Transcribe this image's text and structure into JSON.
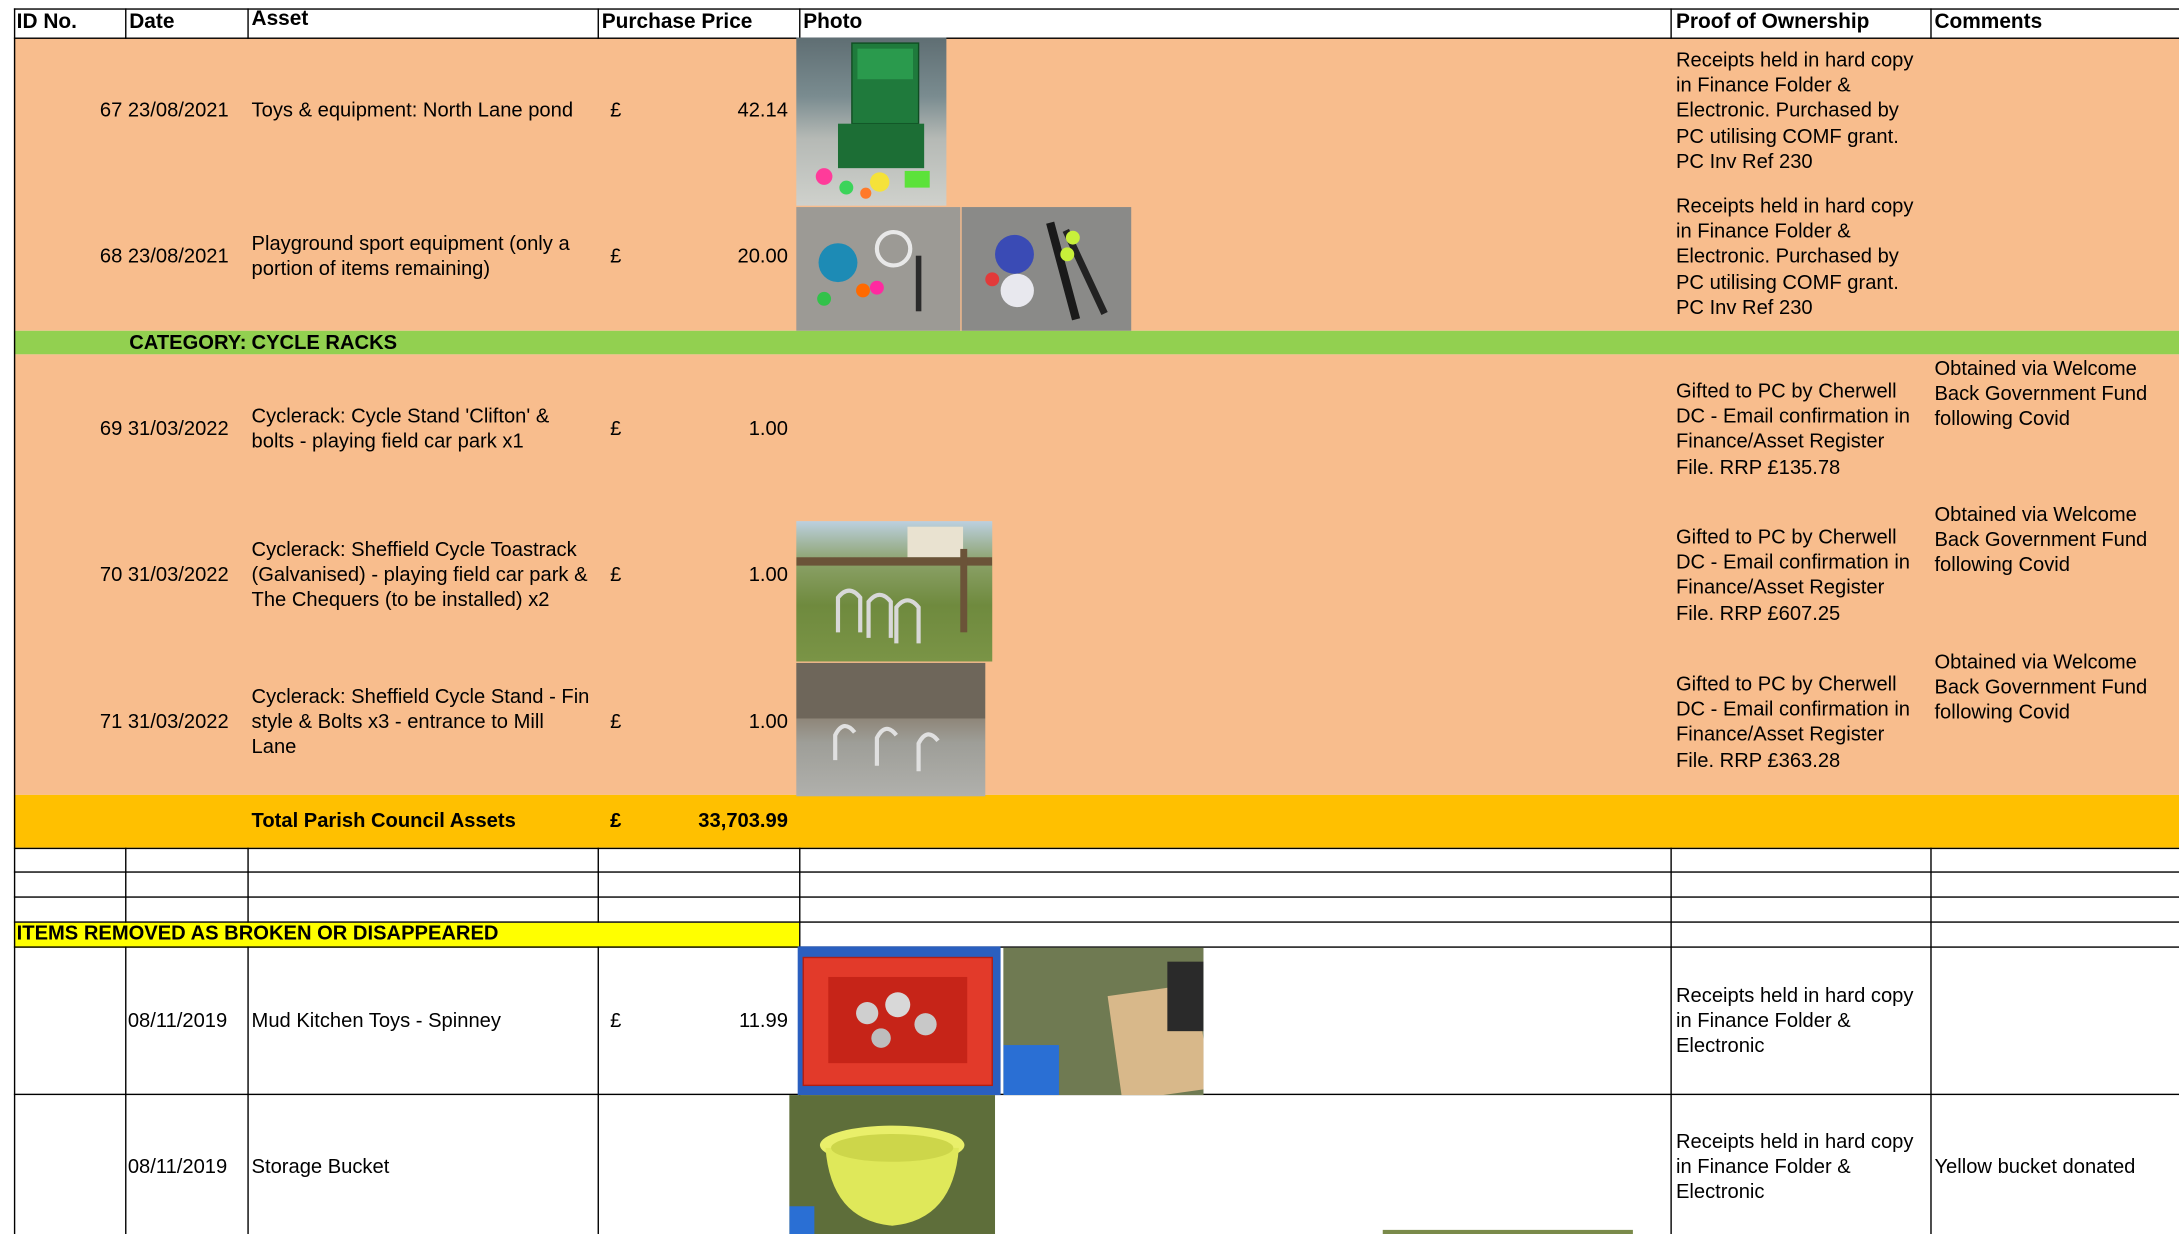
{
  "headers": {
    "id": "ID No.",
    "date": "Date",
    "asset": "Asset",
    "price": "Purchase Price",
    "photo": "Photo",
    "proof": "Proof of Ownership",
    "comments": "Comments"
  },
  "rows": [
    {
      "id": "67",
      "date": "23/08/2021",
      "asset": [
        "Toys & equipment: North Lane pond"
      ],
      "currency": "£",
      "price": "42.14",
      "proof": [
        "Receipts held in hard copy",
        "in Finance Folder &",
        "Electronic. Purchased by",
        "PC utilising COMF grant.",
        "PC Inv Ref 230"
      ],
      "comments": []
    },
    {
      "id": "68",
      "date": "23/08/2021",
      "asset": [
        "Playground sport equipment (only a",
        "portion of items remaining)"
      ],
      "currency": "£",
      "price": "20.00",
      "proof": [
        "Receipts held in hard copy",
        "in Finance Folder &",
        "Electronic. Purchased by",
        "PC utilising COMF grant.",
        "PC Inv Ref 230"
      ],
      "comments": []
    },
    {
      "id": "69",
      "date": "31/03/2022",
      "asset": [
        "Cyclerack: Cycle Stand 'Clifton' &",
        "bolts - playing field car park x1"
      ],
      "currency": "£",
      "price": "1.00",
      "proof": [
        "Gifted to PC by Cherwell",
        "DC - Email confirmation in",
        "Finance/Asset Register",
        "File. RRP £135.78"
      ],
      "comments": [
        "Obtained via Welcome",
        "Back Government Fund",
        "following Covid"
      ]
    },
    {
      "id": "70",
      "date": "31/03/2022",
      "asset": [
        "Cyclerack: Sheffield Cycle Toastrack",
        "(Galvanised) - playing field car park &",
        "The Chequers (to be installed) x2"
      ],
      "currency": "£",
      "price": "1.00",
      "proof": [
        "Gifted to PC by Cherwell",
        "DC - Email confirmation in",
        "Finance/Asset Register",
        "File. RRP £607.25"
      ],
      "comments": [
        "Obtained via Welcome",
        "Back Government Fund",
        "following Covid"
      ]
    },
    {
      "id": "71",
      "date": "31/03/2022",
      "asset": [
        "Cyclerack: Sheffield Cycle Stand - Fin",
        "style & Bolts x3 - entrance to Mill",
        "Lane"
      ],
      "currency": "£",
      "price": "1.00",
      "proof": [
        "Gifted to PC by Cherwell",
        "DC - Email confirmation in",
        "Finance/Asset Register",
        "File. RRP £363.28"
      ],
      "comments": [
        "Obtained via Welcome",
        "Back Government Fund",
        "following Covid"
      ]
    }
  ],
  "category": {
    "label": "CATEGORY:",
    "value": "CYCLE RACKS"
  },
  "total": {
    "label": "Total Parish Council Assets",
    "currency": "£",
    "value": "33,703.99"
  },
  "removed_heading": "ITEMS REMOVED AS BROKEN OR DISAPPEARED",
  "removed": [
    {
      "date": "08/11/2019",
      "asset": "Mud Kitchen Toys - Spinney",
      "currency": "£",
      "price": "11.99",
      "proof": [
        "Receipts held in hard copy",
        "in Finance Folder &",
        "Electronic"
      ],
      "comments": ""
    },
    {
      "date": "08/11/2019",
      "asset": "Storage Bucket",
      "currency": "",
      "price": "",
      "proof": [
        "Receipts held in hard copy",
        "in Finance Folder &",
        "Electronic"
      ],
      "comments": "Yellow bucket donated"
    }
  ],
  "colors": {
    "row_fill": "#F8BD8D",
    "category_fill": "#92D050",
    "total_fill": "#FFC000",
    "removed_heading_fill": "#FFFF00"
  }
}
